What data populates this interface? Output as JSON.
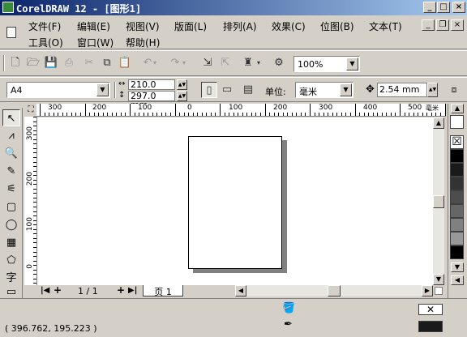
{
  "window": {
    "title": "CorelDRAW 12 - [图形1]",
    "buttons": [
      "_",
      "□",
      "×"
    ]
  },
  "menu": {
    "row1": [
      "文件(F)",
      "编辑(E)",
      "视图(V)",
      "版面(L)",
      "排列(A)",
      "效果(C)",
      "位图(B)",
      "文本(T)"
    ],
    "row2": [
      "工具(O)",
      "窗口(W)",
      "帮助(H)"
    ],
    "mdi_buttons": [
      "_",
      "❐",
      "×"
    ]
  },
  "standard_toolbar": {
    "zoom_level": "100%",
    "icons": [
      "new-icon",
      "open-icon",
      "save-icon",
      "print-icon",
      "cut-icon",
      "copy-icon",
      "paste-icon",
      "undo-icon",
      "redo-icon",
      "import-icon",
      "export-icon",
      "launcher-icon",
      "options-icon"
    ]
  },
  "property_bar": {
    "paper_type": "A4",
    "width": "210.0 mm",
    "height": "297.0 mm",
    "units_label": "单位:",
    "units_value": "毫米",
    "nudge": "2.54 mm"
  },
  "rulers": {
    "horizontal_labels": [
      "300",
      "200",
      "100",
      "0",
      "100",
      "200",
      "300",
      "400",
      "500"
    ],
    "vertical_labels": [
      "300",
      "200",
      "100",
      "0"
    ],
    "unit_glyph": "毫米"
  },
  "page_tabs": {
    "counter": "1 / 1",
    "tab_label": "页 1"
  },
  "palette": {
    "colors": [
      "#ffffff",
      "#000000",
      "#1a1a1a",
      "#333333",
      "#4d4d4d",
      "#666666",
      "#808080",
      "#999999"
    ]
  },
  "status": {
    "coordinates": "( 396.762, 195.223 )",
    "fill_color": "#1a1a1a"
  },
  "toolbox": {
    "tools": [
      "pick-tool",
      "shape-tool",
      "zoom-tool",
      "freehand-tool",
      "smart-fill-tool",
      "rectangle-tool",
      "ellipse-tool",
      "graph-paper-tool",
      "basic-shapes-tool",
      "text-tool",
      "interactive-tool"
    ]
  }
}
